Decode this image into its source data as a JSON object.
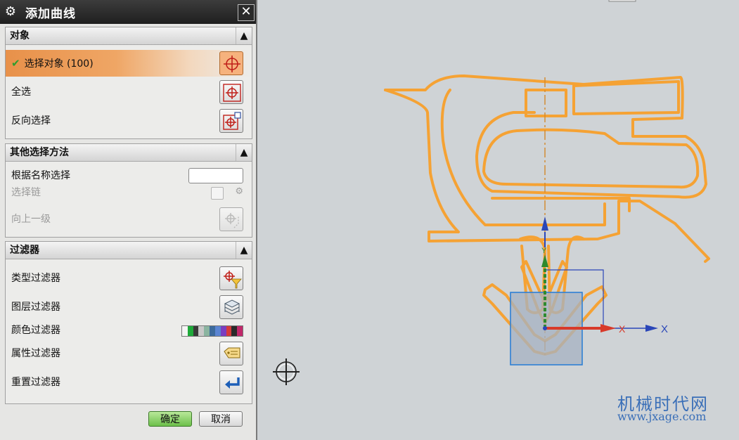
{
  "dialog": {
    "title": "添加曲线",
    "close_glyph": "✕",
    "sections": {
      "objects": {
        "header": "对象",
        "select_objects": "选择对象 (100)",
        "select_all": "全选",
        "invert_selection": "反向选择"
      },
      "other_methods": {
        "header": "其他选择方法",
        "select_by_name": "根据名称选择",
        "select_by_name_value": "",
        "select_chain": "选择链",
        "up_one_level": "向上一级"
      },
      "filters": {
        "header": "过滤器",
        "type_filter": "类型过滤器",
        "layer_filter": "图层过滤器",
        "color_filter": "颜色过滤器",
        "attribute_filter": "属性过滤器",
        "reset_filter": "重置过滤器"
      }
    },
    "ok": "确定",
    "cancel": "取消"
  },
  "colors": {
    "accent_selected": "#e8914a",
    "curve_color": "#f5a234",
    "axis_x_red": "#d83a2a",
    "axis_blue": "#2a46b8",
    "axis_green": "#2e8a2e"
  },
  "color_filter_swatches": [
    "#f4f4f4",
    "#1faa3a",
    "#3a3a3a",
    "#c8c8c8",
    "#8ab4a0",
    "#3c6a9c",
    "#5a84d2",
    "#7a3ec0",
    "#d63a3a",
    "#2a2a2a",
    "#c0286a"
  ],
  "canvas": {
    "axis_x_label_red": "X",
    "axis_x_label_blue": "X",
    "axis_y_label": "Y"
  },
  "watermark": {
    "line1": "机械时代网",
    "line2": "www.jxage.com"
  }
}
